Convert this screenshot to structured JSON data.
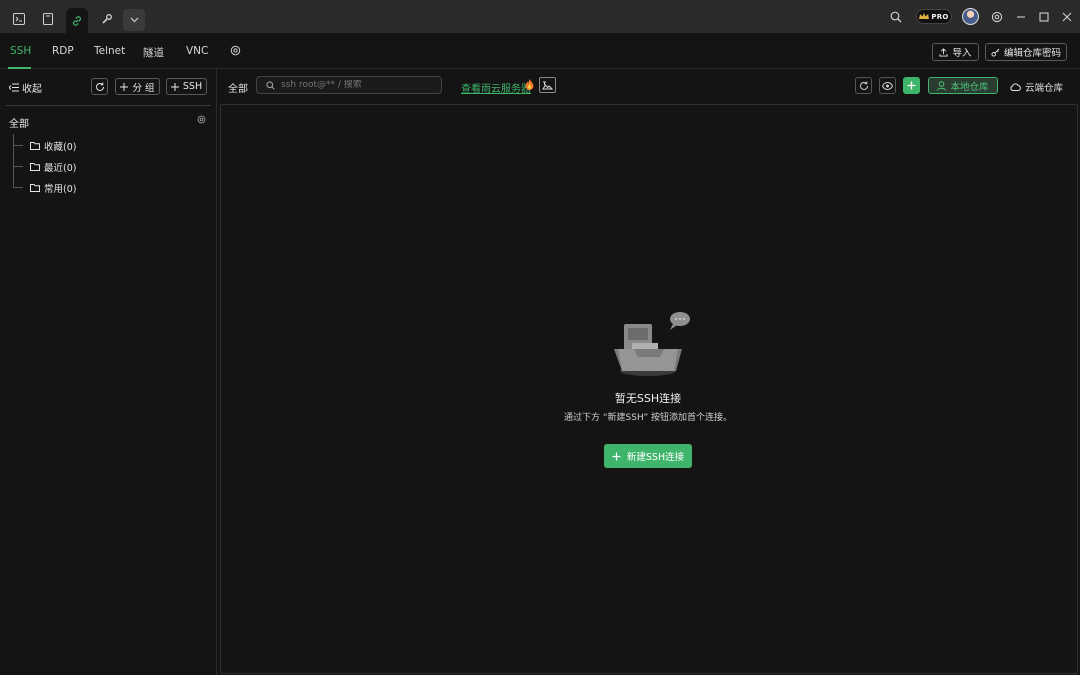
{
  "titlebar": {
    "tabs": [
      {
        "icon": "terminal-icon"
      },
      {
        "icon": "document-icon"
      },
      {
        "icon": "link-icon",
        "active": true
      },
      {
        "icon": "wrench-icon"
      },
      {
        "icon": "chevron-down-icon"
      }
    ],
    "pro_badge": "PRO"
  },
  "protocol_tabs": {
    "items": [
      "SSH",
      "RDP",
      "Telnet",
      "隧道",
      "VNC"
    ],
    "active": "SSH",
    "import_label": "导入",
    "edit_password_label": "编辑仓库密码"
  },
  "sidebar": {
    "collapse_label": "收起",
    "add_group_label": "分 组",
    "add_ssh_label": "SSH",
    "root_label": "全部",
    "groups": [
      {
        "label": "收藏(0)"
      },
      {
        "label": "最近(0)"
      },
      {
        "label": "常用(0)"
      }
    ]
  },
  "main": {
    "filter_label": "全部",
    "search_placeholder": "ssh root@** / 搜索",
    "cloud_link": "查看雨云服务器",
    "local_repo_label": "本地仓库",
    "cloud_repo_label": "云端仓库",
    "empty": {
      "title": "暂无SSH连接",
      "subtitle": "通过下方 “新建SSH” 按钮添加首个连接。",
      "button_label": "新建SSH连接"
    }
  },
  "colors": {
    "accent": "#3fb56b",
    "background": "#141414",
    "titlebar": "#2a2a2a"
  }
}
